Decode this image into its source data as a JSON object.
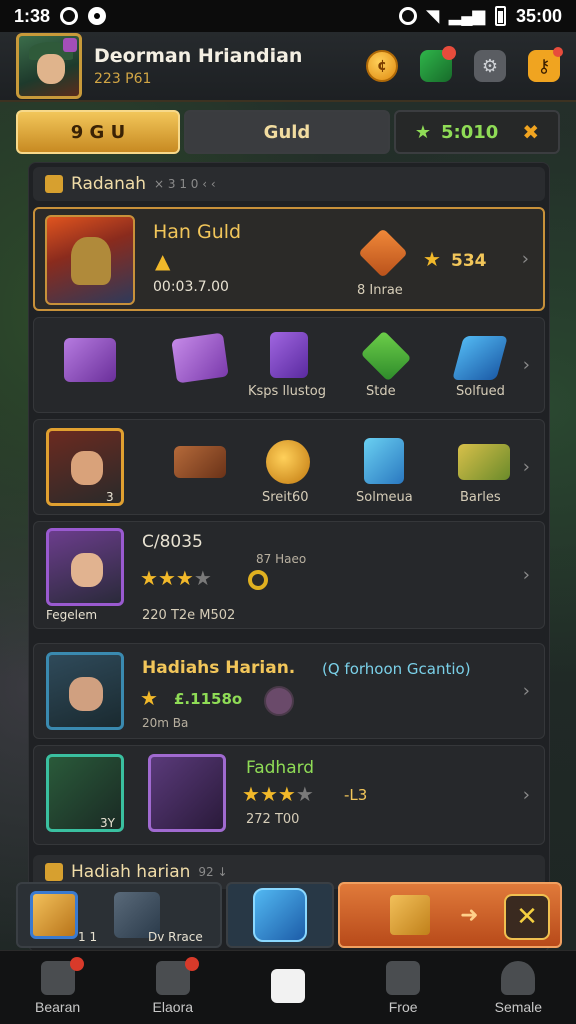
{
  "status_bar": {
    "time": "1:38",
    "clock_right": "35:00"
  },
  "header": {
    "player_name": "Deorman Hriandian",
    "player_sub": "223 P61"
  },
  "tabs": {
    "active_label": "9 G U",
    "guild_label": "Guld",
    "reward_value": "5:010"
  },
  "section1": {
    "title": "Radanah",
    "subtitle": "× 3 1 0 ‹ ‹"
  },
  "guild_card": {
    "title": "Han Guld",
    "timer": "00:03.7.00",
    "score": "534",
    "emblem_label": "8 Inrae"
  },
  "items_row1": {
    "labels": [
      "",
      "Ksps llustog",
      "Stde",
      "Solfued"
    ],
    "qty_a": "",
    "qty_b": ""
  },
  "items_row2": {
    "labels": [
      "Sreit60",
      "Solmeua",
      "Barles"
    ],
    "hero_qty": "3"
  },
  "hero_card1": {
    "name": "Fegelem",
    "code": "C/8035",
    "tag": "87 Haeo",
    "stats": "220 T2e M502",
    "stars_filled": 3,
    "stars_total": 4
  },
  "hero_card2": {
    "name": "Hadiahs Harian.",
    "subtitle": "(Q forhoon Gcantio)",
    "score": "£.1158o",
    "level": "20m Ba"
  },
  "hero_card3": {
    "title": "Fadhard",
    "stats": "272 T00",
    "bonus": "-L3",
    "qty_left": "3Y",
    "stars_filled": 3,
    "stars_total": 4
  },
  "section2": {
    "title": "Hadiah harian",
    "subtitle": "92 ↓"
  },
  "action_bar": {
    "chest_count": "1 1",
    "chest_label": "Dv Rrace"
  },
  "bottom_nav": {
    "items": [
      "Bearan",
      "Elaora",
      "",
      "Froe",
      "Semale"
    ]
  },
  "colors": {
    "accent_gold": "#f2c65a",
    "accent_green": "#8fdc56",
    "accent_orange": "#e07a3a"
  }
}
